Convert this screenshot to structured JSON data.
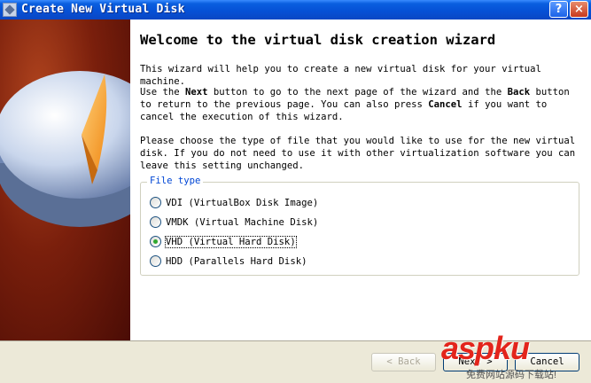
{
  "window": {
    "title": "Create New Virtual Disk",
    "help_label": "?",
    "close_label": "×"
  },
  "content": {
    "heading": "Welcome to the virtual disk creation wizard",
    "para1": "This wizard will help you to create a new virtual disk for your virtual machine.",
    "para2": {
      "t1": "Use the ",
      "b1": "Next",
      "t2": " button to go to the next page of the wizard and the ",
      "b2": "Back",
      "t3": " button to return to the previous page. You can also press ",
      "b3": "Cancel",
      "t4": " if you want to cancel the execution of this wizard."
    },
    "para3": "Please choose the type of file that you would like to use for the new virtual disk. If you do not need to use it with other virtualization software you can leave this setting unchanged."
  },
  "file_type": {
    "title": "File type",
    "options": [
      {
        "label": "VDI (VirtualBox Disk Image)",
        "checked": false
      },
      {
        "label": "VMDK (Virtual Machine Disk)",
        "checked": false
      },
      {
        "label": "VHD (Virtual Hard Disk)",
        "checked": true
      },
      {
        "label": "HDD (Parallels Hard Disk)",
        "checked": false
      }
    ]
  },
  "buttons": {
    "back": "< Back",
    "next": "Next >",
    "cancel": "Cancel"
  },
  "watermark": {
    "text": "aspku",
    "sub": "免费网站源码下载站!"
  },
  "colors": {
    "titlebar": "#0651d6",
    "group_title": "#0046d5",
    "radio_checked": "#2fa82f",
    "watermark": "#e3241b"
  }
}
